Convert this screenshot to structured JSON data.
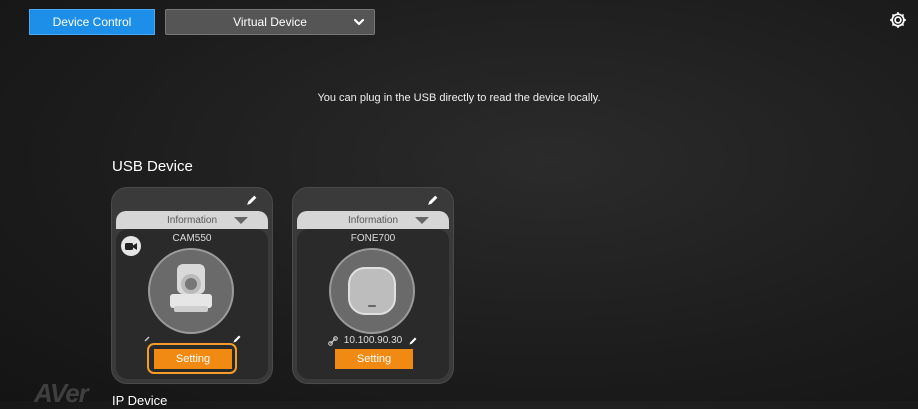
{
  "topbar": {
    "device_control_label": "Device Control",
    "virtual_device_label": "Virtual Device"
  },
  "hint_text": "You can plug in the USB directly to read the device locally.",
  "usb_section_title": "USB Device",
  "ip_section_title": "IP Device",
  "logo_text": "AVer",
  "devices": [
    {
      "info_label": "Information",
      "name": "CAM550",
      "ip": "",
      "setting_label": "Setting",
      "type_icon": "video-camera-icon",
      "highlighted": true
    },
    {
      "info_label": "Information",
      "name": "FONE700",
      "ip": "10.100.90.30",
      "setting_label": "Setting",
      "type_icon": "speakerphone-icon",
      "highlighted": false
    }
  ],
  "colors": {
    "accent_blue": "#1e8fe8",
    "setting_orange": "#f08a12",
    "highlight_orange": "#f39c2a",
    "card_bg": "#3a3a3a"
  }
}
